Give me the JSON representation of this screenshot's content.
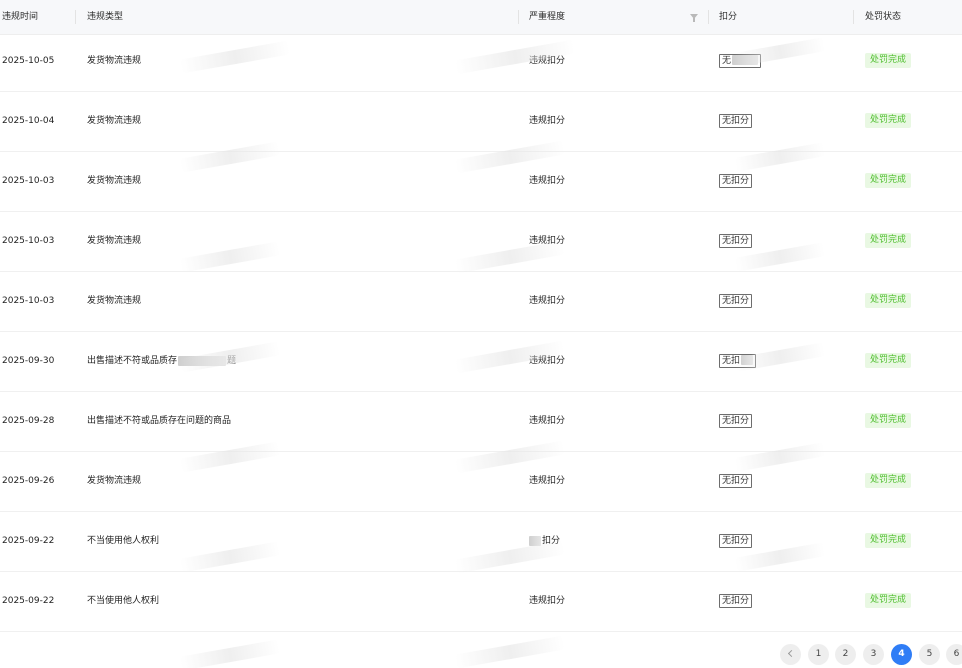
{
  "header": {
    "col_time": "违规时间",
    "col_type": "违规类型",
    "col_severity": "严重程度",
    "col_deduction": "扣分",
    "col_status": "处罚状态"
  },
  "rows": [
    {
      "date": "2025-10-05",
      "type": "发货物流违规",
      "severity": "违规扣分",
      "deduction": "无扣分",
      "status": "处罚完成"
    },
    {
      "date": "2025-10-04",
      "type": "发货物流违规",
      "severity": "违规扣分",
      "deduction": "无扣分",
      "status": "处罚完成"
    },
    {
      "date": "2025-10-03",
      "type": "发货物流违规",
      "severity": "违规扣分",
      "deduction": "无扣分",
      "status": "处罚完成"
    },
    {
      "date": "2025-10-03",
      "type": "发货物流违规",
      "severity": "违规扣分",
      "deduction": "无扣分",
      "status": "处罚完成"
    },
    {
      "date": "2025-10-03",
      "type": "发货物流违规",
      "severity": "违规扣分",
      "deduction": "无扣分",
      "status": "处罚完成"
    },
    {
      "date": "2025-09-30",
      "type": "出售描述不符或品质存",
      "severity": "违规扣分",
      "deduction": "无扣",
      "status": "处罚完成"
    },
    {
      "date": "2025-09-28",
      "type": "出售描述不符或品质存在问题的商品",
      "severity": "违规扣分",
      "deduction": "无扣分",
      "status": "处罚完成"
    },
    {
      "date": "2025-09-26",
      "type": "发货物流违规",
      "severity": "违规扣分",
      "deduction": "无扣分",
      "status": "处罚完成"
    },
    {
      "date": "2025-09-22",
      "type": "不当使用他人权利",
      "severity": "扣分",
      "deduction": "无扣分",
      "status": "处罚完成"
    },
    {
      "date": "2025-09-22",
      "type": "不当使用他人权利",
      "severity": "违规扣分",
      "deduction": "无扣分",
      "status": "处罚完成"
    }
  ],
  "row0_deduction_partial": "无",
  "row5_type_tail": "题",
  "pagination": {
    "pages": [
      "1",
      "2",
      "3",
      "4",
      "5",
      "6"
    ],
    "current": "4"
  },
  "colors": {
    "accent": "#2f7df6",
    "status_green": "#4fbf2e",
    "status_bg": "#e9f8e3",
    "header_bg": "#f7f8fa"
  },
  "icons": {
    "filter": "filter-icon",
    "prev": "chevron-left-icon"
  }
}
